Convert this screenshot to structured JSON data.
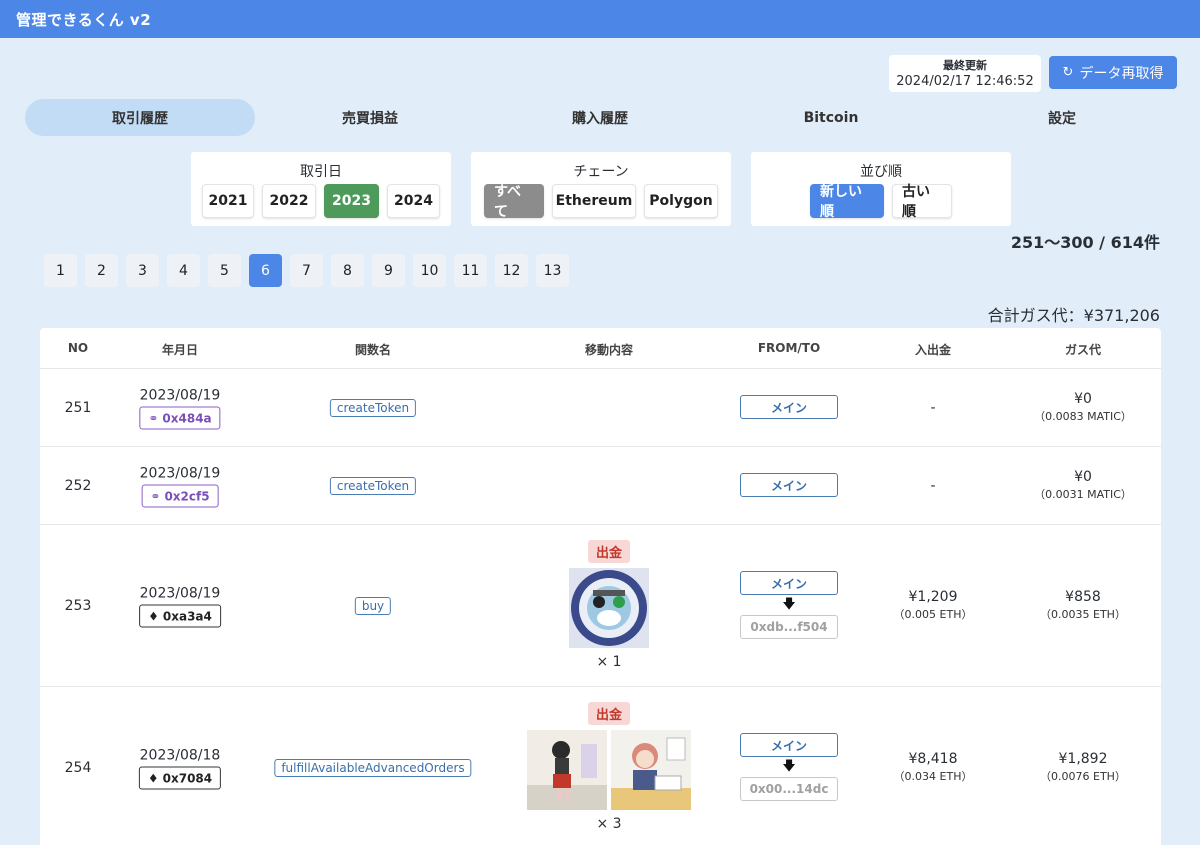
{
  "app": {
    "title": "管理できるくん v2"
  },
  "header": {
    "last_updated_label": "最終更新",
    "last_updated_value": "2024/02/17 12:46:52",
    "refresh_label": "データ再取得"
  },
  "tabs": [
    {
      "label": "取引履歴",
      "active": true
    },
    {
      "label": "売買損益"
    },
    {
      "label": "購入履歴"
    },
    {
      "label": "Bitcoin"
    },
    {
      "label": "設定"
    }
  ],
  "filters": {
    "date": {
      "label": "取引日",
      "options": [
        "2021",
        "2022",
        "2023",
        "2024"
      ],
      "selected": "2023"
    },
    "chain": {
      "label": "チェーン",
      "options": [
        "すべて",
        "Ethereum",
        "Polygon"
      ],
      "selected": "すべて"
    },
    "sort": {
      "label": "並び順",
      "options": [
        "新しい順",
        "古い順"
      ],
      "selected": "新しい順"
    }
  },
  "summary": {
    "range": "251〜300 / 614件",
    "gas_total": "合計ガス代：¥371,206"
  },
  "pagination": {
    "pages": [
      "1",
      "2",
      "3",
      "4",
      "5",
      "6",
      "7",
      "8",
      "9",
      "10",
      "11",
      "12",
      "13"
    ],
    "current": "6"
  },
  "table": {
    "headers": [
      "NO",
      "年月日",
      "関数名",
      "移動内容",
      "FROM/TO",
      "入出金",
      "ガス代"
    ],
    "rows": [
      {
        "no": "251",
        "date": "2023/08/19",
        "tx": "0x484a",
        "chain": "polygon",
        "function": "createToken",
        "from": "メイン",
        "amount": "-",
        "gas": "¥0",
        "gas_native": "（0.0083 MATIC）"
      },
      {
        "no": "252",
        "date": "2023/08/19",
        "tx": "0x2cf5",
        "chain": "polygon",
        "function": "createToken",
        "from": "メイン",
        "amount": "-",
        "gas": "¥0",
        "gas_native": "（0.0031 MATIC）"
      },
      {
        "no": "253",
        "date": "2023/08/19",
        "tx": "0xa3a4",
        "chain": "ethereum",
        "function": "buy",
        "movement_type": "出金",
        "quantity": "× 1",
        "from": "メイン",
        "to": "0xdb...f504",
        "amount": "¥1,209",
        "amount_native": "（0.005 ETH）",
        "gas": "¥858",
        "gas_native": "（0.0035 ETH）"
      },
      {
        "no": "254",
        "date": "2023/08/18",
        "tx": "0x7084",
        "chain": "ethereum",
        "function": "fulfillAvailableAdvancedOrders",
        "movement_type": "出金",
        "quantity": "× 3",
        "from": "メイン",
        "to": "0x00...14dc",
        "amount": "¥8,418",
        "amount_native": "（0.034 ETH）",
        "gas": "¥1,892",
        "gas_native": "（0.0076 ETH）"
      }
    ]
  },
  "colors": {
    "brand": "#4c86e6",
    "year_active": "#4e9a5b",
    "chain_active": "#8c8c8c",
    "out_badge": "#f8d7d7",
    "background": "#e1edf9"
  },
  "icons": {
    "refresh": "refresh-icon",
    "polygon": "polygon-link-icon",
    "ethereum": "ethereum-icon",
    "arrow": "down-arrow-icon"
  }
}
